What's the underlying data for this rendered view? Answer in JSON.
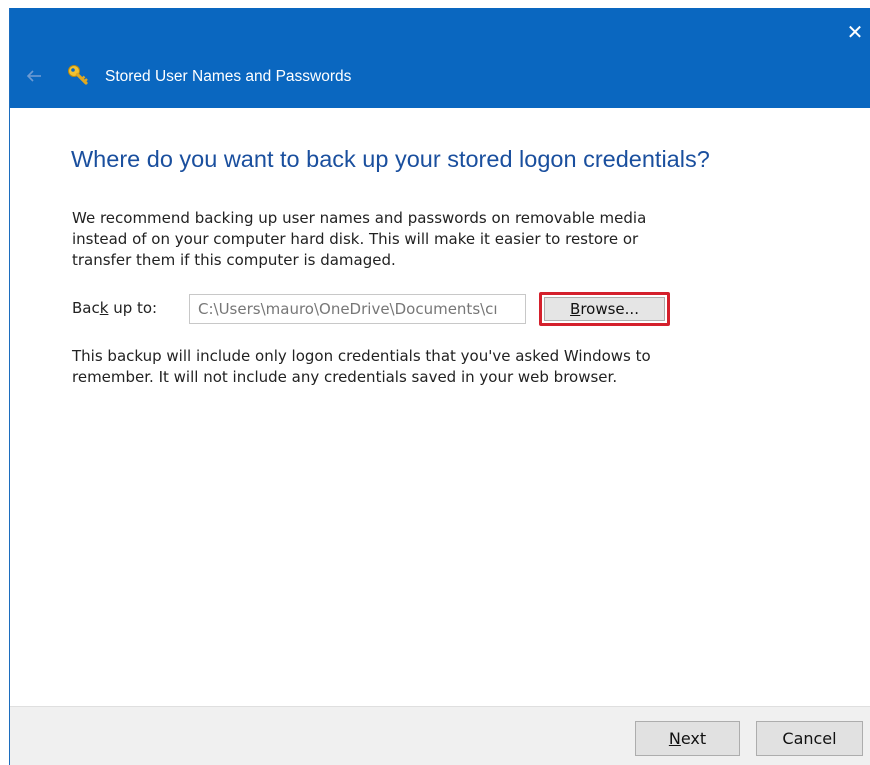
{
  "window": {
    "title": "Stored User Names and Passwords",
    "close_glyph": "✕",
    "back_icon": "back-arrow-icon",
    "key_icon": "key-icon",
    "titlebar_color": "#0a67c0"
  },
  "main": {
    "heading": "Where do you want to back up your stored logon credentials?",
    "intro_line1": "We recommend backing up user names and passwords on removable media",
    "intro_line2": "instead of on your computer hard disk. This will make it easier to restore or",
    "intro_line3": "transfer them if this computer is damaged.",
    "backup_label_pre": "Bac",
    "backup_label_key": "k",
    "backup_label_post": " up to:",
    "backup_path_value": "C:\\Users\\mauro\\OneDrive\\Documents\\cı",
    "browse_label_key": "B",
    "browse_label_post": "rowse...",
    "note_line1": "This backup will include only logon credentials that you've asked Windows to",
    "note_line2": "remember. It will not include any credentials saved in your web browser.",
    "highlight_color": "#d4202c",
    "heading_color": "#1a4f9e"
  },
  "footer": {
    "next_label_key": "N",
    "next_label_post": "ext",
    "cancel_label": "Cancel"
  }
}
